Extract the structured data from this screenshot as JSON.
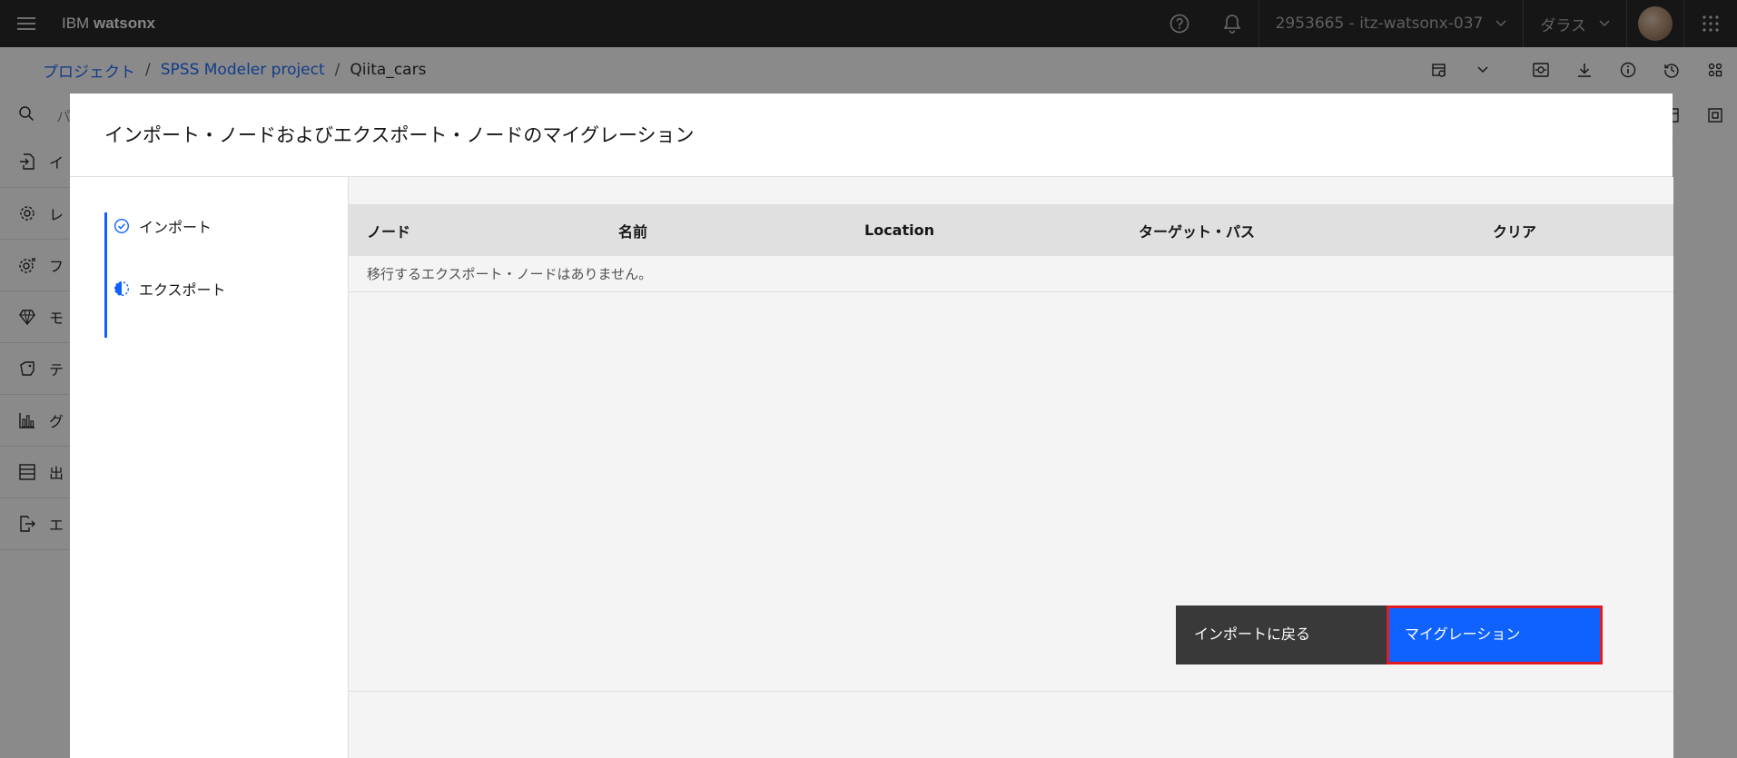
{
  "header": {
    "brand_prefix": "IBM",
    "brand_name": "watsonx",
    "account": "2953665 - itz-watsonx-037",
    "region": "ダラス"
  },
  "breadcrumb": {
    "items": [
      "プロジェクト",
      "SPSS Modeler project"
    ],
    "separator": "/",
    "current": "Qiita_cars"
  },
  "canvas": {
    "search_placeholder": "パ",
    "palette": [
      "イ",
      "レ",
      "フ",
      "モ",
      "テ",
      "グ",
      "出",
      "エ"
    ]
  },
  "modal": {
    "title": "インポート・ノードおよびエクスポート・ノードのマイグレーション",
    "steps": [
      {
        "label": "インポート",
        "state": "complete"
      },
      {
        "label": "エクスポート",
        "state": "current"
      }
    ],
    "table": {
      "columns": [
        "ノード",
        "名前",
        "Location",
        "ターゲット・パス",
        "クリア"
      ],
      "empty_message": "移行するエクスポート・ノードはありません。"
    },
    "buttons": {
      "back": "インポートに戻る",
      "migrate": "マイグレーション"
    }
  },
  "colors": {
    "accent": "#0f62fe",
    "header_bg": "#161616",
    "highlight": "#e01b24"
  }
}
